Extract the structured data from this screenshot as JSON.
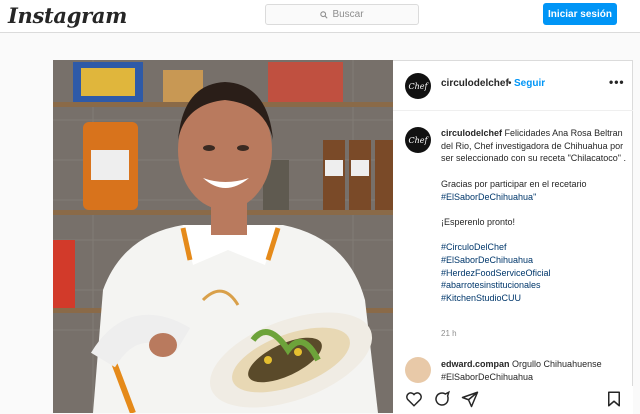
{
  "header": {
    "logo": "Instagram",
    "search_placeholder": "Buscar",
    "login_label": "Iniciar sesión"
  },
  "post": {
    "author": "circulodelchef",
    "avatar_text": "Chef",
    "follow_label": "Seguir",
    "separator": "•",
    "more_label": "•••",
    "caption": {
      "username": "circulodelchef",
      "text": "Felicidades Ana Rosa Beltran del Rio, Chef investigadora de Chihuahua por ser seleccionado con su receta \"Chilacatoco\" .",
      "para2": "Gracias por participar en el recetario",
      "hashtag1": "#ElSaborDeChihuahua\"",
      "para3": "¡Esperenlo pronto!",
      "hashtags": [
        "#CirculoDelChef",
        "#ElSaborDeChihuahua",
        "#HerdezFoodServiceOficial",
        "#abarrotesinstitucionales",
        "#KitchenStudioCUU"
      ]
    },
    "time": "21 h",
    "comment": {
      "username": "edward.compan",
      "text": "Orgullo Chihuahuense #ElSaborDeChihuahua"
    }
  }
}
